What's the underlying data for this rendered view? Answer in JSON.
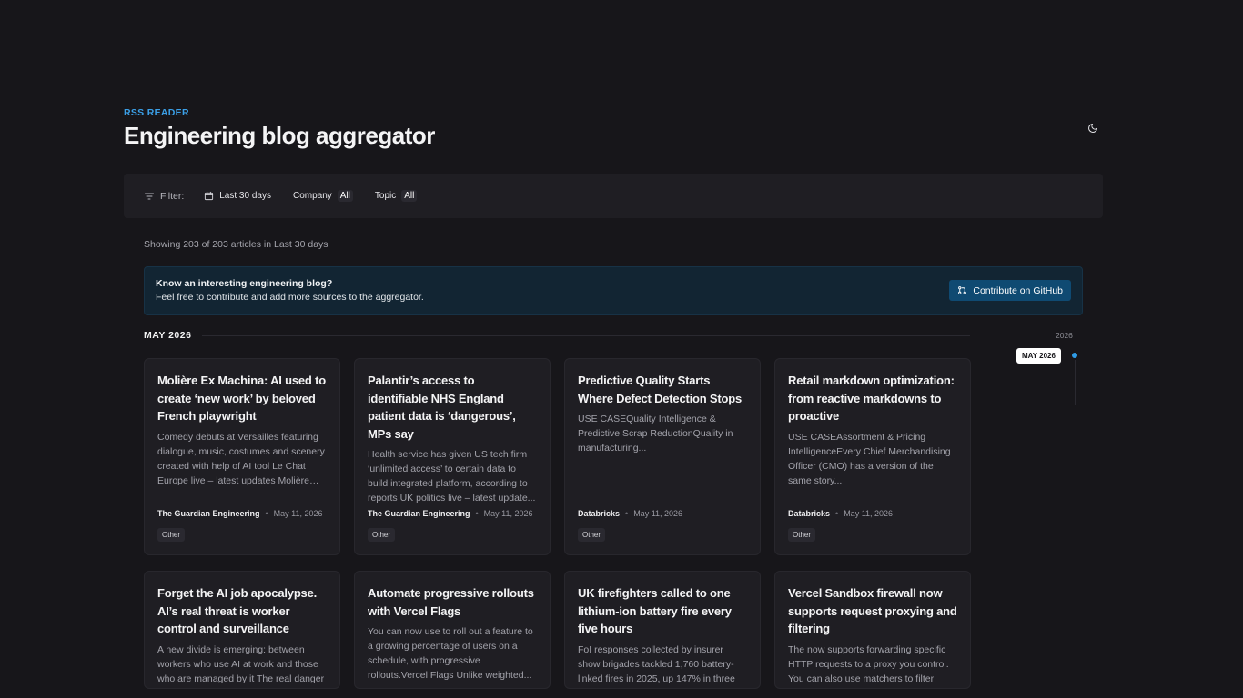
{
  "header": {
    "eyebrow": "RSS READER",
    "title": "Engineering blog aggregator"
  },
  "icons": {
    "theme_toggle": "moon-icon",
    "filter": "filter-icon",
    "calendar": "calendar-icon",
    "github": "git-pull-request-icon"
  },
  "filters": {
    "label": "Filter:",
    "date_range": "Last 30 days",
    "company_label": "Company",
    "company_value": "All",
    "topic_label": "Topic",
    "topic_value": "All"
  },
  "showing": "Showing 203 of 203 articles in Last 30 days",
  "banner": {
    "title": "Know an interesting engineering blog?",
    "subtitle": "Feel free to contribute and add more sources to the aggregator.",
    "button": "Contribute on GitHub"
  },
  "month": "MAY 2026",
  "timeline": {
    "year": "2026",
    "active": "MAY 2026"
  },
  "colors": {
    "background": "#17161a",
    "card": "#1f1e23",
    "accent": "#3ba0e8",
    "button": "#0f4a72"
  },
  "articles": [
    {
      "title": "Molière Ex Machina: AI used to create ‘new work’ by beloved French playwright",
      "summary": "Comedy debuts at Versailles featuring dialogue, music, costumes and scenery created with help of AI tool Le Chat Europe live – latest updates Molière is...",
      "source": "The Guardian Engineering",
      "date": "May 11, 2026",
      "tag": "Other"
    },
    {
      "title": "Palantir’s access to identifiable NHS England patient data is ‘dangerous’, MPs say",
      "summary": "Health service has given US tech firm ‘unlimited access’ to certain data to build integrated platform, according to reports UK politics live – latest update...",
      "source": "The Guardian Engineering",
      "date": "May 11, 2026",
      "tag": "Other"
    },
    {
      "title": "Predictive Quality Starts Where Defect Detection Stops",
      "summary": "USE CASEQuality Intelligence & Predictive Scrap ReductionQuality in manufacturing...",
      "source": "Databricks",
      "date": "May 11, 2026",
      "tag": "Other"
    },
    {
      "title": "Retail markdown optimization: from reactive markdowns to proactive",
      "summary": "USE CASEAssortment & Pricing IntelligenceEvery Chief Merchandising Officer (CMO) has a version of the same story...",
      "source": "Databricks",
      "date": "May 11, 2026",
      "tag": "Other"
    },
    {
      "title": "Forget the AI job apocalypse. AI’s real threat is worker control and surveillance",
      "summary": "A new divide is emerging: between workers who use AI at work and those who are managed by it The real danger"
    },
    {
      "title": "Automate progressive rollouts with Vercel Flags",
      "summary": "You can now use to roll out a feature to a growing percentage of users on a schedule, with progressive rollouts.Vercel Flags Unlike weighted..."
    },
    {
      "title": "UK firefighters called to one lithium-ion battery fire every five hours",
      "summary": "FoI responses collected by insurer show brigades tackled 1,760 battery-linked fires in 2025, up 147% in three"
    },
    {
      "title": "Vercel Sandbox firewall now supports request proxying and filtering",
      "summary": "The now supports forwarding specific HTTP requests to a proxy you control. You can also use matchers to filter"
    }
  ]
}
